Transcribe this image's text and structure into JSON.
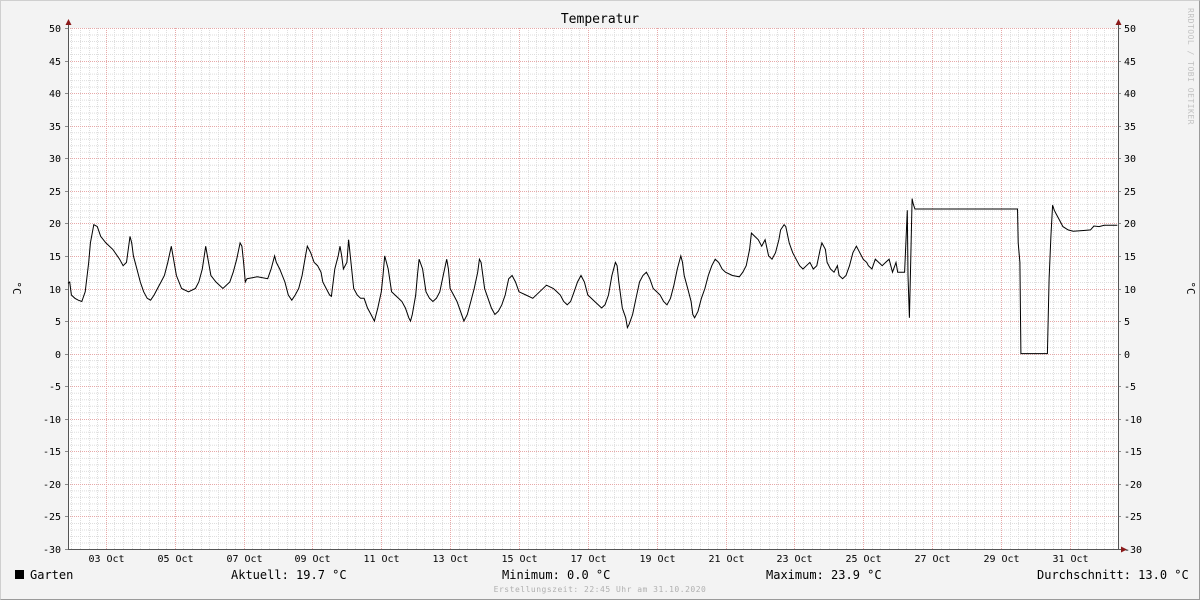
{
  "chart_data": {
    "type": "line",
    "title": "Temperatur",
    "ylabel": "°C",
    "xlabel": "",
    "ylim": [
      -30,
      50
    ],
    "y_ticks": [
      50,
      45,
      40,
      35,
      30,
      25,
      20,
      15,
      10,
      5,
      0,
      -5,
      -10,
      -15,
      -20,
      -25,
      -30
    ],
    "x_day_range": [
      1.9,
      32.4
    ],
    "x_ticks": [
      {
        "day": 3,
        "label": "03 Oct"
      },
      {
        "day": 5,
        "label": "05 Oct"
      },
      {
        "day": 7,
        "label": "07 Oct"
      },
      {
        "day": 9,
        "label": "09 Oct"
      },
      {
        "day": 11,
        "label": "11 Oct"
      },
      {
        "day": 13,
        "label": "13 Oct"
      },
      {
        "day": 15,
        "label": "15 Oct"
      },
      {
        "day": 17,
        "label": "17 Oct"
      },
      {
        "day": 19,
        "label": "19 Oct"
      },
      {
        "day": 21,
        "label": "21 Oct"
      },
      {
        "day": 23,
        "label": "23 Oct"
      },
      {
        "day": 25,
        "label": "25 Oct"
      },
      {
        "day": 27,
        "label": "27 Oct"
      },
      {
        "day": 29,
        "label": "29 Oct"
      },
      {
        "day": 31,
        "label": "31 Oct"
      }
    ],
    "grid": true,
    "series": [
      {
        "name": "Garten",
        "color": "#000000",
        "points": [
          [
            1.9,
            10.8
          ],
          [
            1.95,
            11.0
          ],
          [
            2.0,
            9.0
          ],
          [
            2.1,
            8.5
          ],
          [
            2.2,
            8.2
          ],
          [
            2.3,
            8.0
          ],
          [
            2.4,
            9.5
          ],
          [
            2.5,
            14.0
          ],
          [
            2.55,
            17.0
          ],
          [
            2.65,
            19.8
          ],
          [
            2.75,
            19.5
          ],
          [
            2.85,
            18.0
          ],
          [
            3.0,
            17.0
          ],
          [
            3.2,
            16.0
          ],
          [
            3.4,
            14.5
          ],
          [
            3.5,
            13.5
          ],
          [
            3.6,
            14.0
          ],
          [
            3.7,
            18.0
          ],
          [
            3.75,
            17.0
          ],
          [
            3.8,
            15.0
          ],
          [
            3.9,
            13.0
          ],
          [
            4.0,
            11.0
          ],
          [
            4.1,
            9.5
          ],
          [
            4.2,
            8.5
          ],
          [
            4.3,
            8.2
          ],
          [
            4.4,
            9.0
          ],
          [
            4.5,
            10.0
          ],
          [
            4.6,
            11.0
          ],
          [
            4.7,
            12.0
          ],
          [
            4.8,
            14.0
          ],
          [
            4.9,
            16.5
          ],
          [
            4.95,
            15.0
          ],
          [
            5.05,
            12.0
          ],
          [
            5.2,
            10.0
          ],
          [
            5.4,
            9.5
          ],
          [
            5.6,
            10.0
          ],
          [
            5.7,
            11.0
          ],
          [
            5.8,
            13.0
          ],
          [
            5.9,
            16.5
          ],
          [
            5.95,
            15.0
          ],
          [
            6.05,
            12.0
          ],
          [
            6.2,
            11.0
          ],
          [
            6.4,
            10.0
          ],
          [
            6.6,
            11.0
          ],
          [
            6.7,
            12.5
          ],
          [
            6.8,
            14.5
          ],
          [
            6.9,
            17.0
          ],
          [
            6.95,
            16.5
          ],
          [
            7.0,
            14.0
          ],
          [
            7.05,
            11.0
          ],
          [
            7.1,
            11.5
          ],
          [
            7.4,
            11.8
          ],
          [
            7.7,
            11.5
          ],
          [
            7.8,
            13.0
          ],
          [
            7.9,
            15.0
          ],
          [
            7.95,
            14.0
          ],
          [
            8.05,
            13.0
          ],
          [
            8.2,
            11.0
          ],
          [
            8.3,
            9.0
          ],
          [
            8.4,
            8.2
          ],
          [
            8.5,
            9.0
          ],
          [
            8.6,
            10.0
          ],
          [
            8.7,
            12.0
          ],
          [
            8.8,
            15.0
          ],
          [
            8.85,
            16.5
          ],
          [
            8.95,
            15.5
          ],
          [
            9.05,
            14.0
          ],
          [
            9.15,
            13.5
          ],
          [
            9.25,
            12.5
          ],
          [
            9.3,
            11.0
          ],
          [
            9.4,
            10.0
          ],
          [
            9.5,
            9.0
          ],
          [
            9.55,
            8.8
          ],
          [
            9.65,
            13.0
          ],
          [
            9.75,
            15.0
          ],
          [
            9.8,
            16.5
          ],
          [
            9.85,
            15.0
          ],
          [
            9.9,
            13.0
          ],
          [
            10.0,
            14.0
          ],
          [
            10.05,
            17.5
          ],
          [
            10.1,
            15.0
          ],
          [
            10.2,
            10.0
          ],
          [
            10.3,
            9.0
          ],
          [
            10.4,
            8.5
          ],
          [
            10.5,
            8.5
          ],
          [
            10.6,
            7.0
          ],
          [
            10.7,
            6.0
          ],
          [
            10.8,
            5.0
          ],
          [
            10.9,
            7.0
          ],
          [
            11.0,
            9.5
          ],
          [
            11.05,
            12.0
          ],
          [
            11.1,
            15.0
          ],
          [
            11.2,
            13.0
          ],
          [
            11.3,
            9.5
          ],
          [
            11.4,
            9.0
          ],
          [
            11.5,
            8.5
          ],
          [
            11.6,
            8.0
          ],
          [
            11.7,
            7.0
          ],
          [
            11.8,
            5.5
          ],
          [
            11.85,
            5.0
          ],
          [
            11.9,
            6.0
          ],
          [
            12.0,
            9.0
          ],
          [
            12.05,
            12.0
          ],
          [
            12.1,
            14.5
          ],
          [
            12.2,
            13.0
          ],
          [
            12.3,
            9.5
          ],
          [
            12.4,
            8.5
          ],
          [
            12.5,
            8.0
          ],
          [
            12.6,
            8.5
          ],
          [
            12.7,
            9.5
          ],
          [
            12.8,
            12.0
          ],
          [
            12.9,
            14.5
          ],
          [
            12.95,
            13.0
          ],
          [
            13.0,
            10.0
          ],
          [
            13.1,
            9.0
          ],
          [
            13.2,
            8.0
          ],
          [
            13.3,
            6.5
          ],
          [
            13.4,
            5.0
          ],
          [
            13.5,
            6.0
          ],
          [
            13.6,
            8.0
          ],
          [
            13.7,
            10.0
          ],
          [
            13.8,
            12.5
          ],
          [
            13.85,
            14.5
          ],
          [
            13.9,
            14.0
          ],
          [
            14.0,
            10.0
          ],
          [
            14.1,
            8.5
          ],
          [
            14.2,
            7.0
          ],
          [
            14.3,
            6.0
          ],
          [
            14.4,
            6.5
          ],
          [
            14.5,
            7.5
          ],
          [
            14.6,
            9.0
          ],
          [
            14.7,
            11.5
          ],
          [
            14.8,
            12.0
          ],
          [
            14.9,
            11.0
          ],
          [
            15.0,
            9.5
          ],
          [
            15.2,
            9.0
          ],
          [
            15.4,
            8.5
          ],
          [
            15.6,
            9.5
          ],
          [
            15.8,
            10.5
          ],
          [
            16.0,
            10.0
          ],
          [
            16.1,
            9.5
          ],
          [
            16.2,
            9.0
          ],
          [
            16.3,
            8.0
          ],
          [
            16.4,
            7.5
          ],
          [
            16.5,
            8.0
          ],
          [
            16.6,
            9.5
          ],
          [
            16.7,
            11.0
          ],
          [
            16.8,
            12.0
          ],
          [
            16.9,
            11.0
          ],
          [
            17.0,
            9.0
          ],
          [
            17.1,
            8.5
          ],
          [
            17.2,
            8.0
          ],
          [
            17.3,
            7.5
          ],
          [
            17.4,
            7.0
          ],
          [
            17.5,
            7.5
          ],
          [
            17.6,
            9.0
          ],
          [
            17.7,
            12.0
          ],
          [
            17.8,
            14.0
          ],
          [
            17.85,
            13.5
          ],
          [
            17.9,
            11.0
          ],
          [
            18.0,
            7.0
          ],
          [
            18.1,
            5.5
          ],
          [
            18.15,
            4.0
          ],
          [
            18.2,
            4.5
          ],
          [
            18.3,
            6.0
          ],
          [
            18.4,
            8.5
          ],
          [
            18.5,
            11.0
          ],
          [
            18.6,
            12.0
          ],
          [
            18.7,
            12.5
          ],
          [
            18.8,
            11.5
          ],
          [
            18.9,
            10.0
          ],
          [
            19.0,
            9.5
          ],
          [
            19.1,
            9.0
          ],
          [
            19.2,
            8.0
          ],
          [
            19.3,
            7.5
          ],
          [
            19.4,
            8.5
          ],
          [
            19.5,
            10.5
          ],
          [
            19.6,
            13.0
          ],
          [
            19.7,
            15.0
          ],
          [
            19.75,
            14.0
          ],
          [
            19.8,
            12.0
          ],
          [
            19.9,
            10.0
          ],
          [
            20.0,
            8.0
          ],
          [
            20.05,
            6.0
          ],
          [
            20.1,
            5.5
          ],
          [
            20.2,
            6.5
          ],
          [
            20.3,
            8.5
          ],
          [
            20.4,
            10.0
          ],
          [
            20.5,
            12.0
          ],
          [
            20.6,
            13.5
          ],
          [
            20.7,
            14.5
          ],
          [
            20.8,
            14.0
          ],
          [
            20.9,
            13.0
          ],
          [
            21.0,
            12.5
          ],
          [
            21.2,
            12.0
          ],
          [
            21.4,
            11.8
          ],
          [
            21.5,
            12.5
          ],
          [
            21.6,
            13.5
          ],
          [
            21.7,
            16.0
          ],
          [
            21.75,
            18.5
          ],
          [
            21.85,
            18.0
          ],
          [
            21.95,
            17.5
          ],
          [
            22.05,
            16.5
          ],
          [
            22.15,
            17.5
          ],
          [
            22.25,
            15.0
          ],
          [
            22.35,
            14.5
          ],
          [
            22.45,
            15.5
          ],
          [
            22.55,
            17.5
          ],
          [
            22.6,
            19.0
          ],
          [
            22.7,
            19.8
          ],
          [
            22.75,
            19.5
          ],
          [
            22.85,
            17.0
          ],
          [
            22.95,
            15.5
          ],
          [
            23.05,
            14.5
          ],
          [
            23.15,
            13.5
          ],
          [
            23.25,
            13.0
          ],
          [
            23.35,
            13.5
          ],
          [
            23.45,
            14.0
          ],
          [
            23.55,
            13.0
          ],
          [
            23.65,
            13.5
          ],
          [
            23.75,
            16.0
          ],
          [
            23.8,
            17.0
          ],
          [
            23.9,
            16.0
          ],
          [
            23.95,
            14.0
          ],
          [
            24.05,
            13.0
          ],
          [
            24.15,
            12.5
          ],
          [
            24.25,
            13.5
          ],
          [
            24.3,
            12.0
          ],
          [
            24.4,
            11.5
          ],
          [
            24.5,
            12.0
          ],
          [
            24.6,
            13.5
          ],
          [
            24.7,
            15.5
          ],
          [
            24.8,
            16.5
          ],
          [
            24.9,
            15.5
          ],
          [
            25.0,
            14.5
          ],
          [
            25.1,
            14.0
          ],
          [
            25.15,
            13.5
          ],
          [
            25.25,
            13.0
          ],
          [
            25.35,
            14.5
          ],
          [
            25.45,
            14.0
          ],
          [
            25.55,
            13.5
          ],
          [
            25.65,
            14.0
          ],
          [
            25.75,
            14.5
          ],
          [
            25.8,
            13.5
          ],
          [
            25.85,
            12.5
          ],
          [
            25.95,
            14.0
          ],
          [
            26.0,
            12.5
          ],
          [
            26.2,
            12.5
          ],
          [
            26.28,
            22.0
          ],
          [
            26.3,
            12.0
          ],
          [
            26.34,
            5.5
          ],
          [
            26.37,
            12.0
          ],
          [
            26.42,
            23.8
          ],
          [
            26.45,
            23.0
          ],
          [
            26.5,
            22.2
          ],
          [
            29.48,
            22.2
          ],
          [
            29.5,
            17.0
          ],
          [
            29.55,
            14.0
          ],
          [
            29.58,
            0.0
          ],
          [
            30.35,
            0.0
          ],
          [
            30.4,
            11.5
          ],
          [
            30.45,
            18.0
          ],
          [
            30.5,
            22.8
          ],
          [
            30.55,
            22.0
          ],
          [
            30.6,
            21.5
          ],
          [
            30.7,
            20.5
          ],
          [
            30.8,
            19.5
          ],
          [
            30.95,
            19.0
          ],
          [
            31.1,
            18.8
          ],
          [
            31.4,
            18.9
          ],
          [
            31.6,
            19.0
          ],
          [
            31.7,
            19.6
          ],
          [
            31.85,
            19.5
          ],
          [
            32.0,
            19.7
          ],
          [
            32.38,
            19.7
          ]
        ]
      }
    ]
  },
  "legend": {
    "series_name": "Garten",
    "swatch_color": "#000000",
    "current": "Aktuell: 19.7 °C",
    "minimum": "Minimum: 0.0 °C",
    "maximum": "Maximum: 23.9 °C",
    "average": "Durchschnitt: 13.0 °C"
  },
  "footer": {
    "created": "Erstellungszeit: 22:45 Uhr am 31.10.2020"
  },
  "watermark": "RRDTOOL / TOBI OETIKER"
}
